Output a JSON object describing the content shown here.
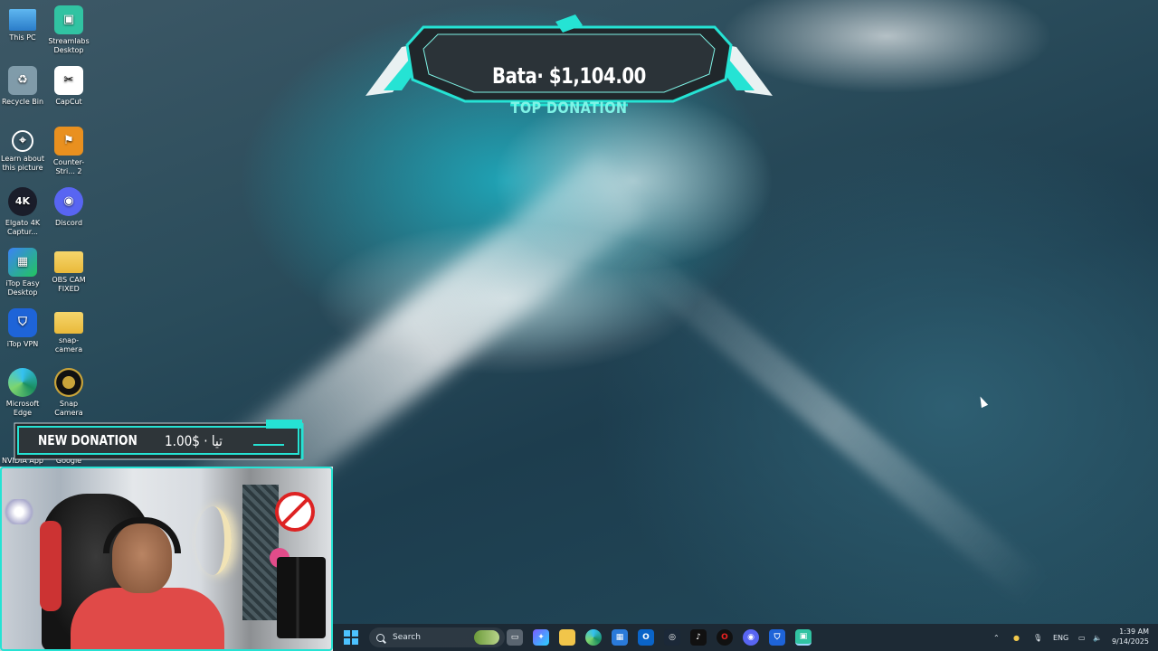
{
  "desktop_icons": [
    {
      "label": "This PC",
      "icon": "this-pc-icon"
    },
    {
      "label": "Streamlabs Desktop",
      "icon": "streamlabs-icon"
    },
    {
      "label": "Recycle Bin",
      "icon": "recycle-bin-icon"
    },
    {
      "label": "CapCut",
      "icon": "capcut-icon"
    },
    {
      "label": "Learn about this picture",
      "icon": "learn-picture-icon"
    },
    {
      "label": "Counter-Stri... 2",
      "icon": "counter-strike-icon"
    },
    {
      "label": "Elgato 4K Captur...",
      "icon": "elgato-icon",
      "glyph": "4K"
    },
    {
      "label": "Discord",
      "icon": "discord-icon"
    },
    {
      "label": "iTop Easy Desktop",
      "icon": "itop-easy-desktop-icon"
    },
    {
      "label": "OBS CAM FIXED",
      "icon": "folder-icon"
    },
    {
      "label": "iTop VPN",
      "icon": "itop-vpn-icon"
    },
    {
      "label": "snap-camera",
      "icon": "folder-icon"
    },
    {
      "label": "Microsoft Edge",
      "icon": "edge-icon"
    },
    {
      "label": "Snap Camera",
      "icon": "snap-camera-icon"
    },
    {
      "label": "NVIDIA App",
      "icon": "nvidia-icon"
    },
    {
      "label": "Google",
      "icon": "google-icon"
    }
  ],
  "top_donation": {
    "amount_text": "Bata· $1,104.00",
    "caption": "TOP DONATION",
    "accent_color": "#25e3d4"
  },
  "new_donation": {
    "label": "NEW DONATION",
    "text": "1.00$ · تيا",
    "accent_color": "#25e3d4"
  },
  "taskbar": {
    "search_placeholder": "Search",
    "apps": [
      "start-icon",
      "task-view-icon",
      "copilot-icon",
      "file-explorer-icon",
      "edge-icon",
      "store-icon",
      "outlook-icon",
      "steam-icon",
      "tiktok-icon",
      "opera-icon",
      "discord-icon",
      "vpn-icon",
      "streamlabs-icon"
    ],
    "tray": {
      "language": "ENG",
      "time": "1:39 AM",
      "date": "9/14/2025"
    }
  }
}
